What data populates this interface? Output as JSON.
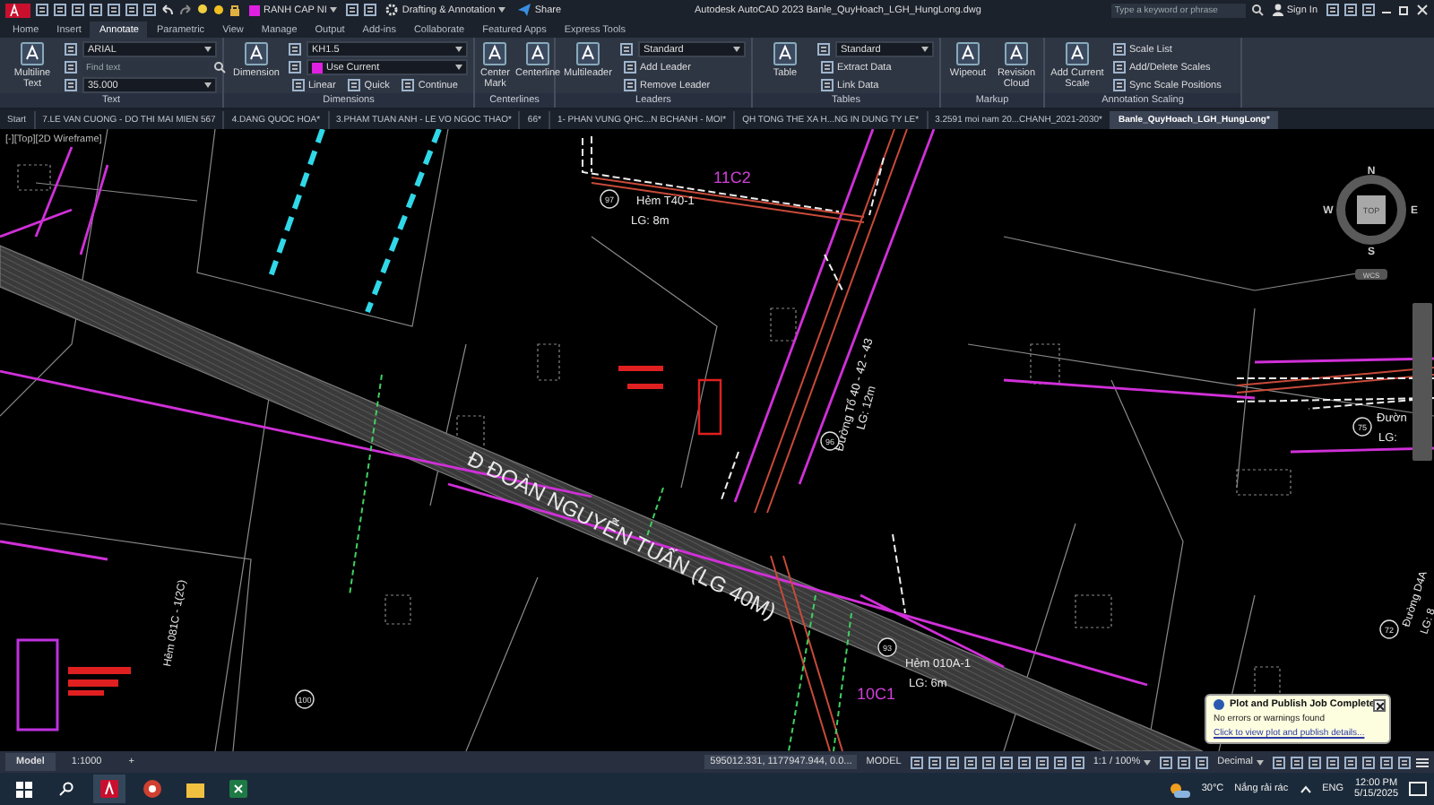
{
  "title_bar": {
    "layer": "RANH CAP NI",
    "workspace": "Drafting & Annotation",
    "share": "Share",
    "title": "Autodesk AutoCAD 2023   Banle_QuyHoach_LGH_HungLong.dwg",
    "search": {
      "placeholder": "Type a keyword or phrase"
    },
    "sign_in": "Sign In"
  },
  "ribbon_tabs": [
    {
      "label": "Home",
      "selected": false
    },
    {
      "label": "Insert",
      "selected": false
    },
    {
      "label": "Annotate",
      "selected": true
    },
    {
      "label": "Parametric",
      "selected": false
    },
    {
      "label": "View",
      "selected": false
    },
    {
      "label": "Manage",
      "selected": false
    },
    {
      "label": "Output",
      "selected": false
    },
    {
      "label": "Add-ins",
      "selected": false
    },
    {
      "label": "Collaborate",
      "selected": false
    },
    {
      "label": "Featured Apps",
      "selected": false
    },
    {
      "label": "Express Tools",
      "selected": false
    }
  ],
  "panels": [
    {
      "title": "Text",
      "large": [
        "Multiline Text"
      ],
      "rows": [
        {
          "kind": "dropdown",
          "value": "ARIAL"
        },
        {
          "kind": "search",
          "placeholder": "Find text"
        },
        {
          "kind": "dropdown",
          "value": "35.000"
        }
      ]
    },
    {
      "title": "Dimensions",
      "large": [
        "Dimension"
      ],
      "rows": [
        {
          "kind": "dropdown",
          "value": "KH1.5"
        },
        {
          "kind": "dropdown",
          "value": "Use Current",
          "color": "#e020e0"
        },
        {
          "kind": "buttons",
          "labels": [
            "Linear",
            "Quick",
            "Continue"
          ]
        }
      ]
    },
    {
      "title": "Centerlines",
      "large": [
        "Center Mark",
        "Centerline"
      ]
    },
    {
      "title": "Leaders",
      "large": [
        "Multileader"
      ],
      "rows": [
        {
          "kind": "dropdown",
          "value": "Standard"
        },
        {
          "kind": "buttons",
          "labels": [
            "Add Leader"
          ]
        },
        {
          "kind": "buttons",
          "labels": [
            "Remove Leader"
          ]
        }
      ]
    },
    {
      "title": "Tables",
      "large": [
        "Table"
      ],
      "rows": [
        {
          "kind": "dropdown",
          "value": "Standard"
        },
        {
          "kind": "buttons",
          "labels": [
            "Extract Data"
          ]
        },
        {
          "kind": "buttons",
          "labels": [
            "Link Data"
          ]
        }
      ]
    },
    {
      "title": "Markup",
      "large": [
        "Wipeout",
        "Revision Cloud"
      ]
    },
    {
      "title": "Annotation Scaling",
      "large": [
        "Add Current Scale"
      ],
      "rows": [
        {
          "kind": "buttons",
          "labels": [
            "Scale List"
          ]
        },
        {
          "kind": "buttons",
          "labels": [
            "Add/Delete Scales"
          ]
        },
        {
          "kind": "buttons",
          "labels": [
            "Sync Scale Positions"
          ]
        }
      ]
    }
  ],
  "file_tabs": [
    {
      "label": "Start",
      "selected": false
    },
    {
      "label": "7.LE VAN CUONG - DO THI MAI MIEN 567",
      "selected": false
    },
    {
      "label": "4.DANG QUOC HOA*",
      "selected": false
    },
    {
      "label": "3.PHAM TUAN ANH - LE VO NGOC THAO*",
      "selected": false
    },
    {
      "label": "66*",
      "selected": false
    },
    {
      "label": "1- PHAN VUNG QHC...N BCHANH - MOI*",
      "selected": false
    },
    {
      "label": "QH TONG THE XA H...NG IN DUNG TY LE*",
      "selected": false
    },
    {
      "label": "3.2591 moi nam 20...CHANH_2021-2030*",
      "selected": false
    },
    {
      "label": "Banle_QuyHoach_LGH_HungLong*",
      "selected": true
    }
  ],
  "viewport": {
    "label": "[-][Top][2D Wireframe]",
    "compass": {
      "north": "N",
      "south": "S",
      "east": "E",
      "west": "W",
      "face": "TOP",
      "ucs": "WCS"
    },
    "labels": [
      {
        "kind": "street",
        "text": "Đ ĐOÀN NGUYỄN TUẤN (LG 40M)"
      },
      {
        "kind": "text",
        "text": "Hẻm T40-1"
      },
      {
        "kind": "text",
        "text": "LG: 8m"
      },
      {
        "kind": "zone",
        "text": "11C2"
      },
      {
        "kind": "text",
        "text": "Đường Tổ 40 - 42 - 43"
      },
      {
        "kind": "text",
        "text": "LG: 12m"
      },
      {
        "kind": "text",
        "text": "Hẻm 010A-1"
      },
      {
        "kind": "text",
        "text": "LG: 6m"
      },
      {
        "kind": "zone",
        "text": "10C1"
      },
      {
        "kind": "text",
        "text": "Hẻm 081C - 1(2C)"
      },
      {
        "kind": "text",
        "text": "Đườn"
      },
      {
        "kind": "text",
        "text": "LG:"
      },
      {
        "kind": "text",
        "text": "Đường D4A"
      },
      {
        "kind": "text",
        "text": "LG: 8"
      },
      {
        "kind": "circled",
        "text": "97"
      },
      {
        "kind": "circled",
        "text": "96"
      },
      {
        "kind": "circled",
        "text": "93"
      },
      {
        "kind": "circled",
        "text": "75"
      },
      {
        "kind": "circled",
        "text": "72"
      },
      {
        "kind": "circled",
        "text": "100"
      }
    ]
  },
  "notification": {
    "title": "Plot and Publish Job Complete",
    "message": "No errors or warnings found",
    "link": "Click to view plot and publish details..."
  },
  "status_bar": {
    "layout_tabs": [
      {
        "label": "Model",
        "selected": true
      },
      {
        "label": "1:1000",
        "selected": false
      }
    ],
    "add": "+",
    "coordinates": "595012.331, 1177947.944, 0.0...",
    "space": "MODEL",
    "annotation_scale": "1:1 / 100%",
    "units": "Decimal"
  },
  "taskbar": {
    "temperature": "30°C",
    "weather": "Nắng rải rác",
    "language": "ENG",
    "time": "12:00 PM",
    "date": "5/15/2025"
  }
}
